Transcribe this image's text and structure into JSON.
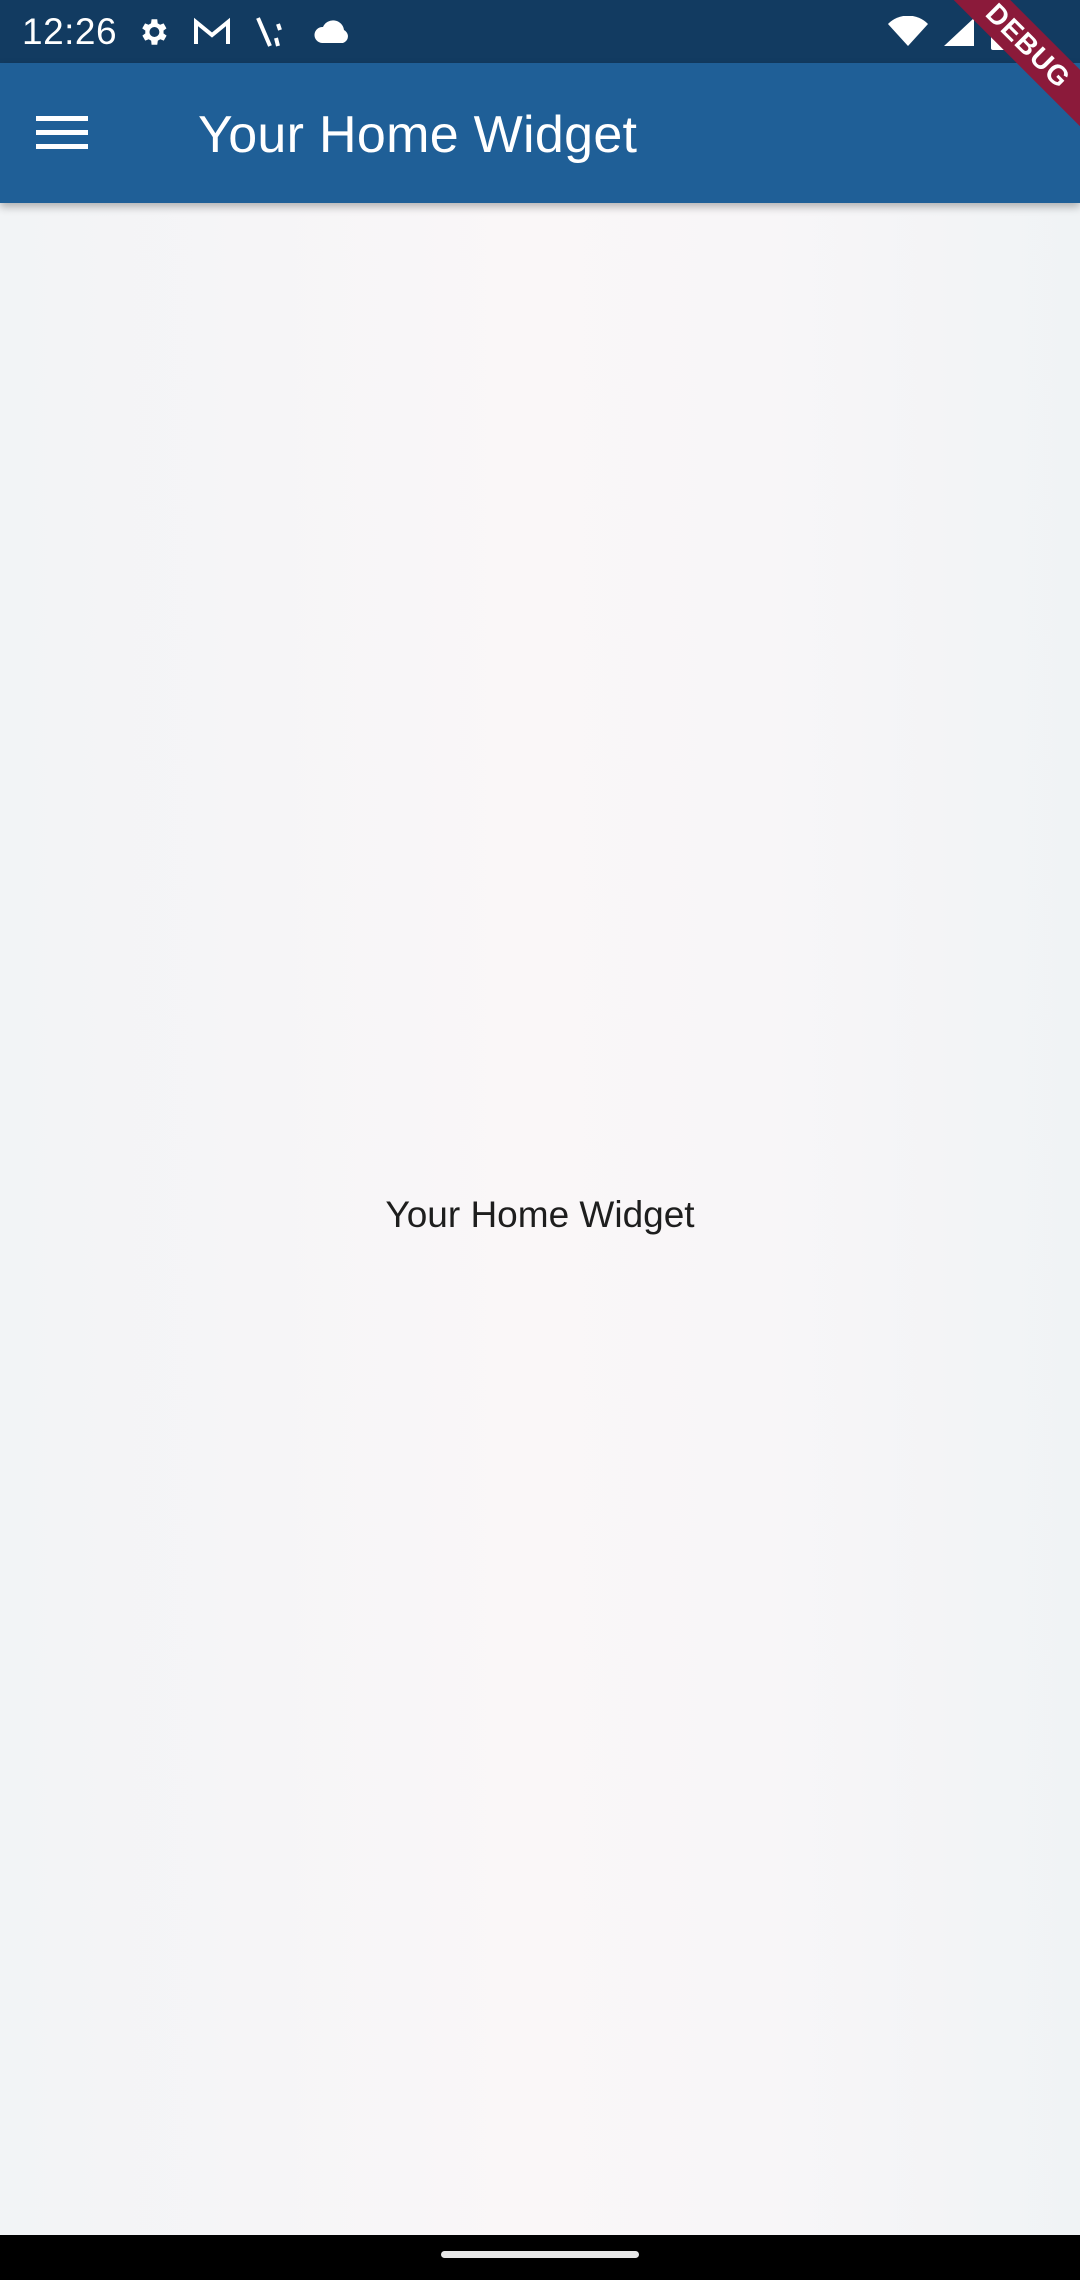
{
  "status_bar": {
    "time": "12:26",
    "left_icons": [
      "settings-icon",
      "gmail-icon",
      "signal-v-icon",
      "cloud-icon"
    ],
    "right_icons": [
      "wifi-icon",
      "cell-signal-icon",
      "battery-icon"
    ]
  },
  "app_bar": {
    "title": "Your Home Widget",
    "menu_icon": "menu-icon",
    "debug_banner": "DEBUG",
    "color": "#1f5f97"
  },
  "body": {
    "center_text": "Your Home Widget"
  },
  "nav_bar": {
    "home_indicator": "home-indicator"
  },
  "colors": {
    "status_bar": "#123b61",
    "app_bar": "#1f5f97",
    "debug_banner": "#8b1a3a",
    "background": "#f4f5f7"
  }
}
